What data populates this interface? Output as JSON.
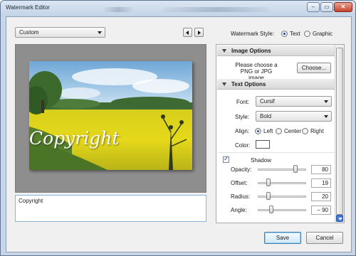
{
  "window": {
    "title": "Watermark Editor",
    "minimize_glyph": "–",
    "maximize_glyph": "▭",
    "close_glyph": "✕"
  },
  "preset": {
    "selected": "Custom"
  },
  "watermark_style": {
    "label": "Watermark Style:",
    "options": [
      {
        "label": "Text",
        "selected": true
      },
      {
        "label": "Graphic",
        "selected": false
      }
    ]
  },
  "preview": {
    "watermark_text": "Copyright"
  },
  "text_input": {
    "value": "Copyright"
  },
  "image_options": {
    "header": "Image Options",
    "prompt": "Please choose a PNG or JPG image",
    "choose_button": "Choose..."
  },
  "text_options": {
    "header": "Text Options",
    "font_label": "Font:",
    "font_value": "Cursif",
    "style_label": "Style:",
    "style_value": "Bold",
    "align_label": "Align:",
    "align_options": [
      {
        "label": "Left",
        "selected": true
      },
      {
        "label": "Center",
        "selected": false
      },
      {
        "label": "Right",
        "selected": false
      }
    ],
    "color_label": "Color:",
    "color_value": "#ffffff"
  },
  "shadow": {
    "label": "Shadow",
    "enabled": true,
    "rows": [
      {
        "label": "Opacity:",
        "value": "80",
        "level": 0.8
      },
      {
        "label": "Offset:",
        "value": "19",
        "level": 0.19
      },
      {
        "label": "Radius:",
        "value": "20",
        "level": 0.2
      },
      {
        "label": "Angle:",
        "value": "– 90",
        "level": 0.25
      }
    ]
  },
  "footer": {
    "save": "Save",
    "cancel": "Cancel"
  },
  "colors": {
    "accent": "#3b78d6",
    "titlebar": "#c7d5e6"
  }
}
